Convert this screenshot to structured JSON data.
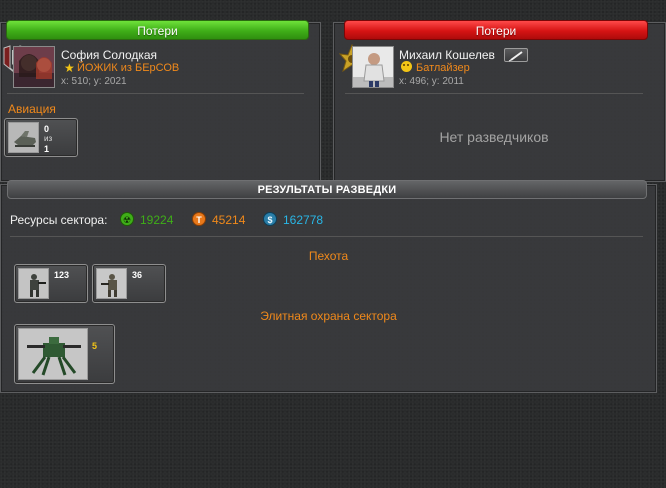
{
  "left": {
    "header": "Потери",
    "player_name": "София Солодкая",
    "clan": "ЙОЖИК из БЕрСОВ",
    "coords": "x: 510; y: 2021",
    "section": "Авиация",
    "unit": {
      "count_top": "0",
      "count_mid": "из",
      "count_bot": "1"
    }
  },
  "right": {
    "header": "Потери",
    "player_name": "Михаил Кошелев",
    "clan": "Батлайзер",
    "coords": "x: 496; y: 2011",
    "empty_text": "Нет разведчиков"
  },
  "results": {
    "title": "РЕЗУЛЬТАТЫ РАЗВЕДКИ",
    "resources_label": "Ресурсы сектора:",
    "resources": [
      {
        "icon": "radiation-icon",
        "value": "19224",
        "color": "#3fae18"
      },
      {
        "icon": "titanium-icon",
        "value": "45214",
        "color": "#f0891b"
      },
      {
        "icon": "credits-icon",
        "value": "162778",
        "color": "#29b6e6"
      }
    ],
    "infantry_title": "Пехота",
    "infantry": [
      {
        "count": "123"
      },
      {
        "count": "36"
      }
    ],
    "elite_title": "Элитная охрана сектора",
    "elite": [
      {
        "count": "5"
      }
    ]
  },
  "colors": {
    "green_bar": "#3fae18",
    "red_bar": "#d61414",
    "orange_text": "#f0891b"
  }
}
